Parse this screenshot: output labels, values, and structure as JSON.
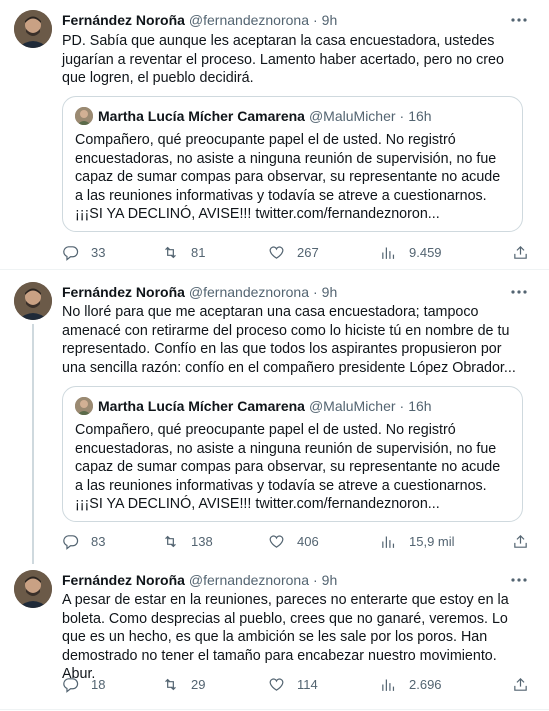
{
  "colors": {
    "text": "#0f1419",
    "secondary": "#536471",
    "border": "#cfd9de",
    "divider": "#eff3f4"
  },
  "icons": {
    "reply": "reply-icon",
    "retweet": "retweet-icon",
    "like": "heart-icon",
    "views": "views-icon",
    "share": "share-icon",
    "more": "more-icon"
  },
  "tweets": [
    {
      "name": "Fernández Noroña",
      "handle": "@fernandeznorona",
      "sep": "·",
      "time": "9h",
      "text": "PD. Sabía que aunque les aceptaran la casa encuestadora, ustedes jugarían a reventar el proceso. Lamento haber acertado, pero no creo que logren, el pueblo decidirá.",
      "quote": {
        "name": "Martha Lucía Mícher Camarena",
        "handle": "@MaluMicher",
        "sep": "·",
        "time": "16h",
        "text": "Compañero, qué preocupante papel el de usted. No registró encuestadoras, no asiste a ninguna reunión de supervisión, no fue capaz de sumar compas para observar, su representante no acude a las reuniones informativas y todavía se atreve a cuestionarnos. ¡¡¡SI YA DECLINÓ, AVISE!!! twitter.com/fernandeznoron..."
      },
      "replies": "33",
      "retweets": "81",
      "likes": "267",
      "views": "9.459"
    },
    {
      "name": "Fernández Noroña",
      "handle": "@fernandeznorona",
      "sep": "·",
      "time": "9h",
      "text": "No lloré para que me aceptaran una casa encuestadora; tampoco amenacé con retirarme del proceso como lo hiciste tú en nombre de tu representado. Confío en las que todos los aspirantes propusieron por una sencilla razón: confío en el compañero presidente López Obrador...",
      "quote": {
        "name": "Martha Lucía Mícher Camarena",
        "handle": "@MaluMicher",
        "sep": "·",
        "time": "16h",
        "text": "Compañero, qué preocupante papel el de usted. No registró encuestadoras, no asiste a ninguna reunión de supervisión, no fue capaz de sumar compas para observar, su representante no acude a las reuniones informativas y todavía se atreve a cuestionarnos. ¡¡¡SI YA DECLINÓ, AVISE!!! twitter.com/fernandeznoron..."
      },
      "replies": "83",
      "retweets": "138",
      "likes": "406",
      "views": "15,9 mil"
    },
    {
      "name": "Fernández Noroña",
      "handle": "@fernandeznorona",
      "sep": "·",
      "time": "9h",
      "text": "A pesar de estar en la reuniones, pareces no enterarte que estoy en la boleta. Como desprecias al pueblo, crees que no ganaré, veremos. Lo que es un hecho, es que la ambición se les sale por los poros. Han demostrado no tener el tamaño para encabezar nuestro movimiento. Abur.",
      "replies": "18",
      "retweets": "29",
      "likes": "114",
      "views": "2.696"
    }
  ]
}
